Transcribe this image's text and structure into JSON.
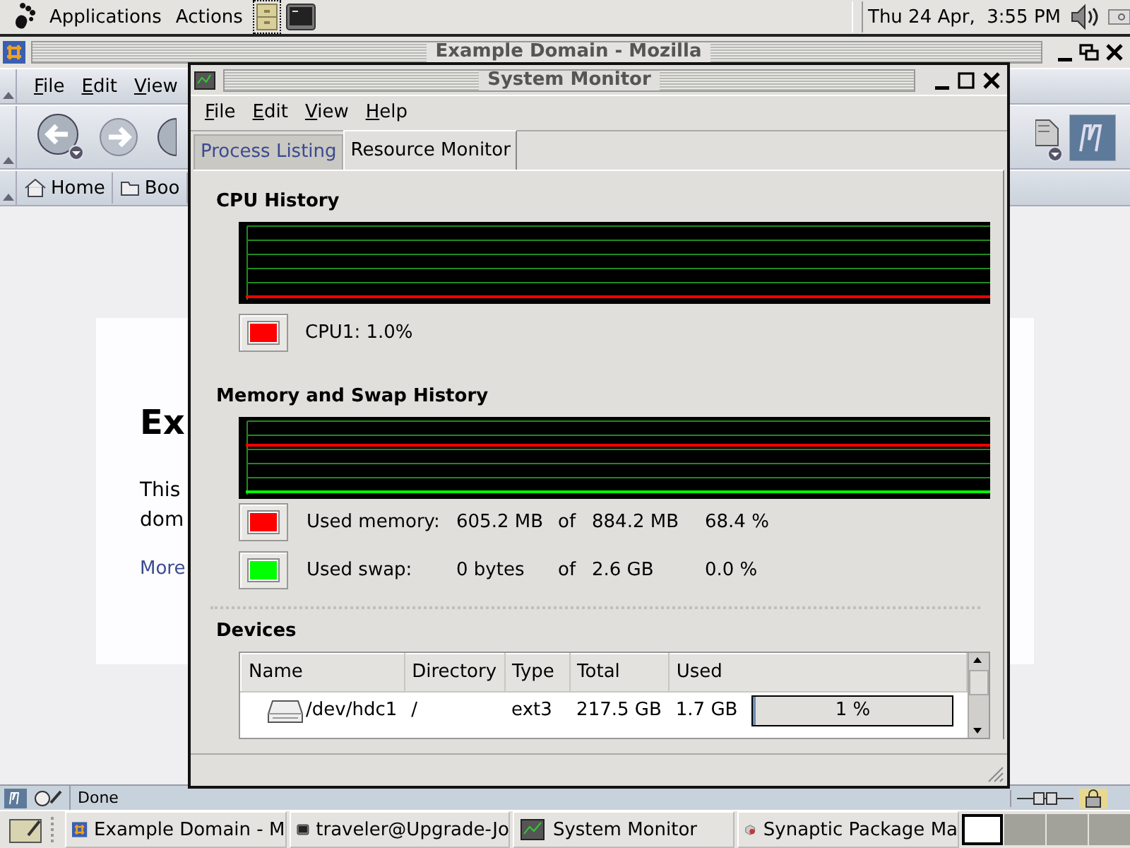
{
  "top_panel": {
    "menus": [
      "Applications",
      "Actions"
    ],
    "clock": "Thu 24 Apr,  3:55 PM"
  },
  "browser": {
    "title": "Example Domain - Mozilla",
    "menus": [
      "File",
      "Edit",
      "View"
    ],
    "bookmarks": [
      "Home",
      "Boo"
    ],
    "page": {
      "heading": "Ex",
      "lines": [
        "This",
        "dom"
      ],
      "link": "More"
    },
    "status": "Done"
  },
  "monitor": {
    "title": "System Monitor",
    "menus": [
      "File",
      "Edit",
      "View",
      "Help"
    ],
    "tabs": [
      {
        "label": "Process Listing",
        "selected": false
      },
      {
        "label": "Resource Monitor",
        "selected": true
      }
    ],
    "cpu_title": "CPU History",
    "cpus": [
      {
        "label": "CPU1:",
        "value": "1.0%",
        "color": "#ff0000"
      }
    ],
    "memory_title": "Memory and Swap History",
    "memory": [
      {
        "label": "Used memory:",
        "used": "605.2 MB",
        "of": "of",
        "total": "884.2 MB",
        "percent": "68.4 %",
        "color": "#ff0000"
      },
      {
        "label": "Used swap:",
        "used": "0 bytes",
        "of": "of",
        "total": "2.6 GB",
        "percent": "0.0 %",
        "color": "#00ff00"
      }
    ],
    "devices_title": "Devices",
    "devices": {
      "columns": [
        "Name",
        "Directory",
        "Type",
        "Total",
        "Used"
      ],
      "rows": [
        {
          "name": "/dev/hdc1",
          "directory": "/",
          "type": "ext3",
          "total": "217.5 GB",
          "used": "1.7 GB",
          "level": 0.01,
          "reading": "1 %"
        }
      ]
    }
  },
  "taskbar": {
    "items": [
      {
        "label": "Example Domain - M",
        "kind": "browser"
      },
      {
        "label": "traveler@Upgrade-Jo",
        "kind": "terminal"
      },
      {
        "label": "System Monitor",
        "kind": "monitor"
      },
      {
        "label": "Synaptic Package Ma",
        "kind": "package"
      }
    ],
    "workspaces": [
      {
        "selected": true
      },
      {
        "selected": false
      },
      {
        "selected": false
      },
      {
        "selected": false
      }
    ]
  }
}
